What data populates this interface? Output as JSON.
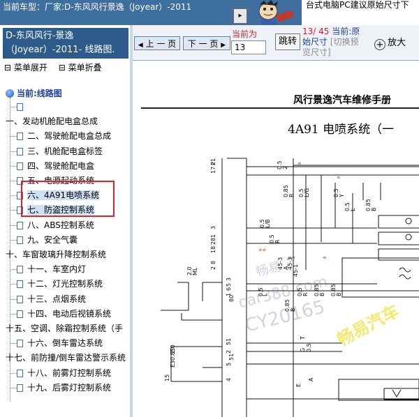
{
  "top": {
    "current_model_label": "当前车型：",
    "current_model_value": "厂家:D-东风风行景逸（Joyear）-2011",
    "ad_text": "台式电脑PC建议原始尺寸下"
  },
  "left": {
    "title_line1": "D-东风风行-景逸",
    "title_line2": "（Joyear）-2011- 线路图.",
    "expand_label": "菜单展开",
    "collapse_label": "菜单折叠",
    "tree_root": "当前:线路图",
    "items": [
      {
        "label": "",
        "kind": "doc"
      },
      {
        "label": "一、发动机舱配电盒总成",
        "kind": "folder"
      },
      {
        "label": "二、驾驶舱配电盒总成",
        "kind": "doc"
      },
      {
        "label": "三、机舱配电盒标签",
        "kind": "doc"
      },
      {
        "label": "四、驾驶舱配电盒",
        "kind": "doc"
      },
      {
        "label": "五、电源起动系统",
        "kind": "doc"
      },
      {
        "label": "六、4A91电喷系统",
        "kind": "doc"
      },
      {
        "label": "七、防盗控制系统",
        "kind": "doc"
      },
      {
        "label": "八、ABS控制系统",
        "kind": "doc"
      },
      {
        "label": "九、安全气囊",
        "kind": "doc"
      },
      {
        "label": "十、车窗玻璃升降控制系统",
        "kind": "folder"
      },
      {
        "label": "十一、车室内灯",
        "kind": "doc"
      },
      {
        "label": "十二、灯光控制系统",
        "kind": "doc"
      },
      {
        "label": "十三、点烟系统",
        "kind": "doc"
      },
      {
        "label": "十四、电动后视镜系统",
        "kind": "doc"
      },
      {
        "label": "十五、空调、除霜控制系统（手",
        "kind": "folder"
      },
      {
        "label": "十六、倒车雷达系统",
        "kind": "doc"
      },
      {
        "label": "十七、前防撞/倒车雷达警示系统",
        "kind": "folder"
      },
      {
        "label": "十八、前雾灯控制系统",
        "kind": "doc"
      },
      {
        "label": "十九、后雾灯控制系统",
        "kind": "doc"
      }
    ]
  },
  "toolbar": {
    "prev_label": "上 一 页",
    "next_label": "下 一 页",
    "page_label": "当前为",
    "page_value": "13",
    "jump_label": "跳转",
    "page_info_count": "13/ 45",
    "page_info_current": "当前:原",
    "page_info_size": "始尺寸",
    "page_info_switch": "[切换预",
    "page_info_switch2": "览尺寸]",
    "zoom_label": "放大"
  },
  "document": {
    "manual_header": "风行景逸汽车维修手册",
    "section_title": "4A91 电喷系统（一",
    "watermarks": [
      "畅易",
      "car388.com",
      "CY20165",
      "畅易汽车"
    ],
    "labels": [
      "2",
      "17",
      "3",
      "1",
      "28",
      "18",
      "8",
      "2",
      "2",
      "0.5",
      "R",
      "0.85",
      "L/G",
      "0.5",
      "Y",
      "0.5",
      "L",
      "0.5",
      "B",
      "0.85",
      "L/B",
      "0.5",
      "R",
      "0.5",
      "L",
      "0.5",
      "ML",
      "2.0",
      "R",
      "0.5",
      "B",
      "0.85",
      "B",
      "0.85",
      "B",
      "0.85",
      "3",
      "5",
      "6",
      "1",
      "80",
      "51",
      "2",
      "51",
      "5",
      "0.5",
      "G",
      "4",
      "A",
      "E",
      "A",
      "45-3",
      "45-1",
      "45-3",
      "T",
      "2.0",
      "0.85",
      "E3",
      "15",
      "P1"
    ]
  },
  "colors": {
    "topbar": "#3e6f9e",
    "left_title": "#2c5b8a",
    "accent_red": "#e0212b",
    "link_blue": "#1f3f9a"
  },
  "icons": [
    "document-icon",
    "tree-root-icon",
    "zoom-icon",
    "page-arrow-icon",
    "mascot-icon"
  ]
}
